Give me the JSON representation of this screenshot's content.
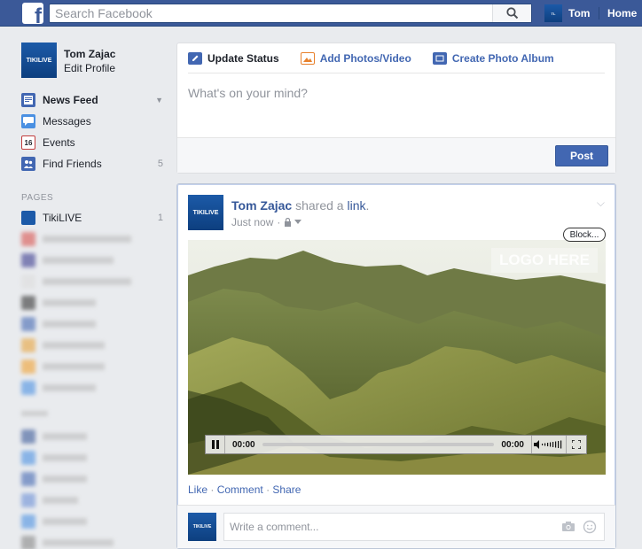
{
  "topbar": {
    "logo": "f",
    "search_placeholder": "Search Facebook",
    "user_name": "Tom",
    "home_label": "Home",
    "search_icon": "search-icon",
    "brand_color": "#3b5998"
  },
  "profile": {
    "name": "Tom Zajac",
    "edit_label": "Edit Profile",
    "avatar_text": "TIKILIVE"
  },
  "sidebar": {
    "items": [
      {
        "label": "News Feed",
        "icon": "news-feed-icon"
      },
      {
        "label": "Messages",
        "icon": "messages-icon"
      },
      {
        "label": "Events",
        "icon": "events-icon",
        "icon_text": "16"
      },
      {
        "label": "Find Friends",
        "icon": "find-friends-icon",
        "count": "5"
      }
    ],
    "pages_heading": "PAGES",
    "pages": [
      {
        "label": "TikiLIVE",
        "count": "1"
      }
    ]
  },
  "composer": {
    "tabs": [
      {
        "label": "Update Status",
        "icon": "pencil-icon"
      },
      {
        "label": "Add Photos/Video",
        "icon": "photo-icon"
      },
      {
        "label": "Create Photo Album",
        "icon": "album-icon"
      }
    ],
    "placeholder": "What's on your mind?",
    "post_label": "Post"
  },
  "story": {
    "author": "Tom Zajac",
    "action": "shared a",
    "link_text": "link",
    "period": ".",
    "time": "Just now",
    "block_label": "Block...",
    "video": {
      "logo_text": "LOGO HERE",
      "current_time": "00:00",
      "duration": "00:00",
      "progress": 0
    },
    "actions": {
      "like": "Like",
      "comment": "Comment",
      "share": "Share",
      "separator": "·"
    },
    "comment_placeholder": "Write a comment..."
  }
}
